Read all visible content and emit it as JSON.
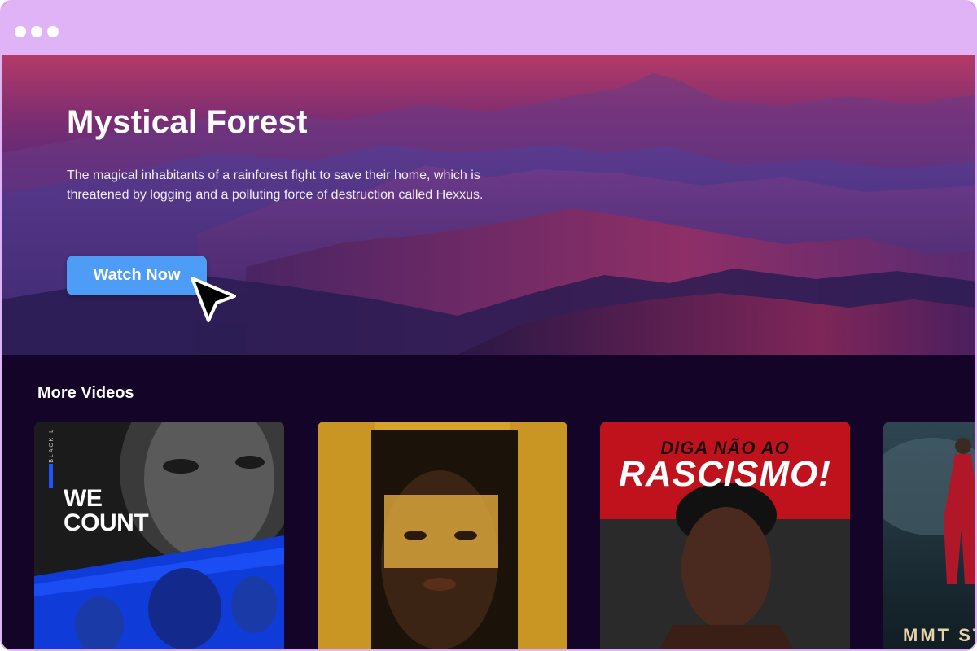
{
  "window": {
    "dots": [
      "red",
      "yellow",
      "green"
    ]
  },
  "hero": {
    "title": "Mystical Forest",
    "description": "The magical inhabitants of a rainforest fight to save their home, which is threatened by logging and a polluting force of destruction called Hexxus.",
    "cta_label": "Watch Now"
  },
  "more_videos": {
    "heading": "More Videos",
    "cards": [
      {
        "poster_text": "WE\nCOUNT",
        "side_text": "BLACK L"
      },
      {
        "poster_text": ""
      },
      {
        "poster_text_top": "DIGA NÃO AO",
        "poster_text_main": "RASCISMO!"
      },
      {
        "poster_text": "MMT STR"
      }
    ]
  },
  "colors": {
    "titlebar": "#e0b3f7",
    "accent_button": "#4d9cf5",
    "page_bg": "#130428"
  }
}
